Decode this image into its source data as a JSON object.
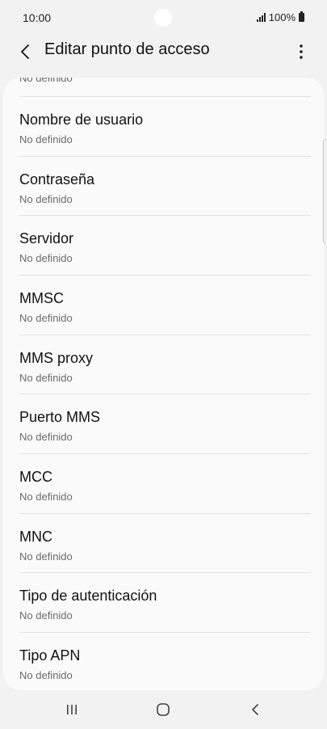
{
  "status_bar": {
    "time": "10:00",
    "battery": "100%"
  },
  "app_bar": {
    "title": "Editar punto de acceso"
  },
  "list": {
    "clipped_top_value": "No definido",
    "items": [
      {
        "title": "Nombre de usuario",
        "value": "No definido"
      },
      {
        "title": "Contraseña",
        "value": "No definido"
      },
      {
        "title": "Servidor",
        "value": "No definido"
      },
      {
        "title": "MMSC",
        "value": "No definido"
      },
      {
        "title": "MMS proxy",
        "value": "No definido"
      },
      {
        "title": "Puerto MMS",
        "value": "No definido"
      },
      {
        "title": "MCC",
        "value": "No definido"
      },
      {
        "title": "MNC",
        "value": "No definido"
      },
      {
        "title": "Tipo de autenticación",
        "value": "No definido"
      },
      {
        "title": "Tipo APN",
        "value": "No definido"
      }
    ]
  },
  "icons": {
    "back": "back-arrow-icon",
    "more": "more-options-icon",
    "recents": "recents-icon",
    "home": "home-icon",
    "nav_back": "back-icon"
  }
}
